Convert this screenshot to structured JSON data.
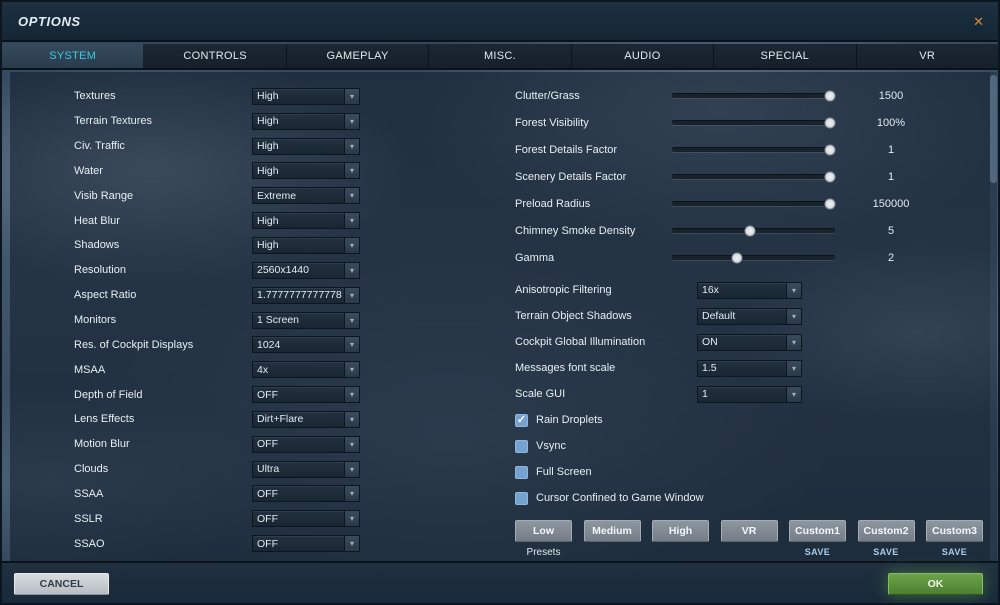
{
  "colors": {
    "accent-cyan": "#3fc6e4",
    "ok-green": "#5c9440",
    "cancel-gray": "#c9ced3",
    "checkbox-blue": "#74a3d1",
    "save-blue": "#a6cdec",
    "close-orange": "#d9873c"
  },
  "window": {
    "title": "OPTIONS",
    "close_glyph": "✕"
  },
  "tabs": [
    {
      "label": "SYSTEM",
      "active": true
    },
    {
      "label": "CONTROLS",
      "active": false
    },
    {
      "label": "GAMEPLAY",
      "active": false
    },
    {
      "label": "MISC.",
      "active": false
    },
    {
      "label": "AUDIO",
      "active": false
    },
    {
      "label": "SPECIAL",
      "active": false
    },
    {
      "label": "VR",
      "active": false
    }
  ],
  "left_settings": [
    {
      "label": "Textures",
      "value": "High"
    },
    {
      "label": "Terrain Textures",
      "value": "High"
    },
    {
      "label": "Civ. Traffic",
      "value": "High"
    },
    {
      "label": "Water",
      "value": "High"
    },
    {
      "label": "Visib Range",
      "value": "Extreme"
    },
    {
      "label": "Heat Blur",
      "value": "High"
    },
    {
      "label": "Shadows",
      "value": "High"
    },
    {
      "label": "Resolution",
      "value": "2560x1440"
    },
    {
      "label": "Aspect Ratio",
      "value": "1.7777777777778"
    },
    {
      "label": "Monitors",
      "value": "1 Screen"
    },
    {
      "label": "Res. of Cockpit Displays",
      "value": "1024"
    },
    {
      "label": "MSAA",
      "value": "4x"
    },
    {
      "label": "Depth of Field",
      "value": "OFF"
    },
    {
      "label": "Lens Effects",
      "value": "Dirt+Flare"
    },
    {
      "label": "Motion Blur",
      "value": "OFF"
    },
    {
      "label": "Clouds",
      "value": "Ultra"
    },
    {
      "label": "SSAA",
      "value": "OFF"
    },
    {
      "label": "SSLR",
      "value": "OFF"
    },
    {
      "label": "SSAO",
      "value": "OFF"
    }
  ],
  "sliders": [
    {
      "label": "Clutter/Grass",
      "value": "1500",
      "percent": 97
    },
    {
      "label": "Forest Visibility",
      "value": "100%",
      "percent": 97
    },
    {
      "label": "Forest Details Factor",
      "value": "1",
      "percent": 97
    },
    {
      "label": "Scenery Details Factor",
      "value": "1",
      "percent": 97
    },
    {
      "label": "Preload Radius",
      "value": "150000",
      "percent": 97
    },
    {
      "label": "Chimney Smoke Density",
      "value": "5",
      "percent": 48
    },
    {
      "label": "Gamma",
      "value": "2",
      "percent": 40
    }
  ],
  "right_settings": [
    {
      "label": "Anisotropic Filtering",
      "value": "16x"
    },
    {
      "label": "Terrain Object Shadows",
      "value": "Default"
    },
    {
      "label": "Cockpit Global Illumination",
      "value": "ON"
    },
    {
      "label": "Messages font scale",
      "value": "1.5"
    },
    {
      "label": "Scale GUI",
      "value": "1"
    }
  ],
  "checkboxes": [
    {
      "label": "Rain Droplets",
      "checked": true,
      "check_glyph": "✓"
    },
    {
      "label": "Vsync",
      "checked": false,
      "check_glyph": "✓"
    },
    {
      "label": "Full Screen",
      "checked": false,
      "check_glyph": "✓"
    },
    {
      "label": "Cursor Confined to Game Window",
      "checked": false,
      "check_glyph": "✓"
    }
  ],
  "presets": [
    {
      "label": "Low",
      "sub": "Presets",
      "is_save": false
    },
    {
      "label": "Medium",
      "sub": "",
      "is_save": false
    },
    {
      "label": "High",
      "sub": "",
      "is_save": false
    },
    {
      "label": "VR",
      "sub": "",
      "is_save": false
    },
    {
      "label": "Custom1",
      "sub": "SAVE",
      "is_save": true
    },
    {
      "label": "Custom2",
      "sub": "SAVE",
      "is_save": true
    },
    {
      "label": "Custom3",
      "sub": "SAVE",
      "is_save": true
    }
  ],
  "footer": {
    "cancel_label": "CANCEL",
    "ok_label": "OK"
  },
  "dropdown_arrow_glyph": "▾"
}
